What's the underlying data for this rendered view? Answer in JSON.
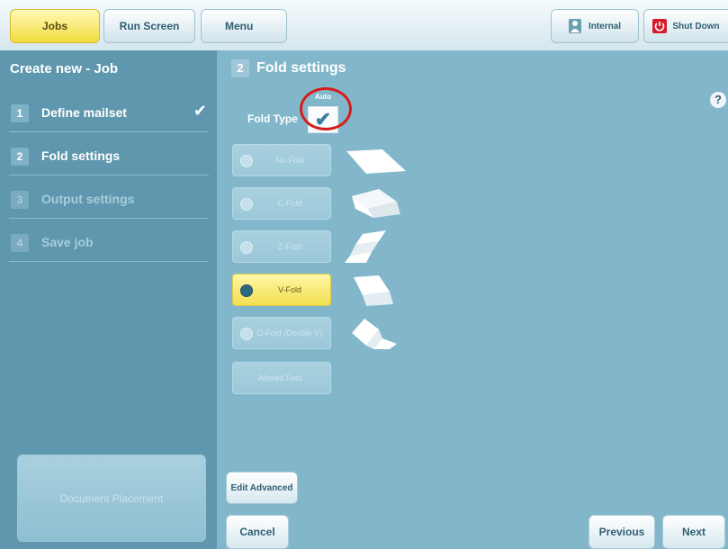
{
  "topbar": {
    "jobs": "Jobs",
    "run_screen": "Run Screen",
    "menu": "Menu",
    "internal": "Internal",
    "shutdown": "Shut Down"
  },
  "sidebar": {
    "title": "Create new - Job",
    "steps": [
      {
        "num": "1",
        "label": "Define mailset",
        "state": "done"
      },
      {
        "num": "2",
        "label": "Fold settings",
        "state": "current"
      },
      {
        "num": "3",
        "label": "Output settings",
        "state": "disabled"
      },
      {
        "num": "4",
        "label": "Save job",
        "state": "disabled"
      }
    ],
    "document_placement": "Document Placement"
  },
  "main": {
    "step_num": "2",
    "title": "Fold settings",
    "help": "?",
    "fold_type_label": "Fold Type",
    "auto_label": "Auto",
    "auto_checked": true,
    "fold_options": [
      {
        "label": "No Fold",
        "selected": false,
        "icon": "no-fold-icon"
      },
      {
        "label": "C-Fold",
        "selected": false,
        "icon": "c-fold-icon"
      },
      {
        "label": "Z-Fold",
        "selected": false,
        "icon": "z-fold-icon"
      },
      {
        "label": "V-Fold",
        "selected": true,
        "icon": "v-fold-icon"
      },
      {
        "label": "D-Fold (Double V)",
        "selected": false,
        "icon": "d-fold-icon"
      }
    ],
    "altered_fold": "Altered Fold",
    "edit_advanced": "Edit Advanced",
    "cancel": "Cancel",
    "previous": "Previous",
    "next": "Next"
  },
  "colors": {
    "sidebar_bg": "#5f97ae",
    "main_bg": "#82b7cb",
    "active_tab": "#f2dd3c",
    "selected_option": "#f2df50",
    "highlight_circle": "#d81b1b",
    "shutdown_icon": "#d81b2b"
  }
}
